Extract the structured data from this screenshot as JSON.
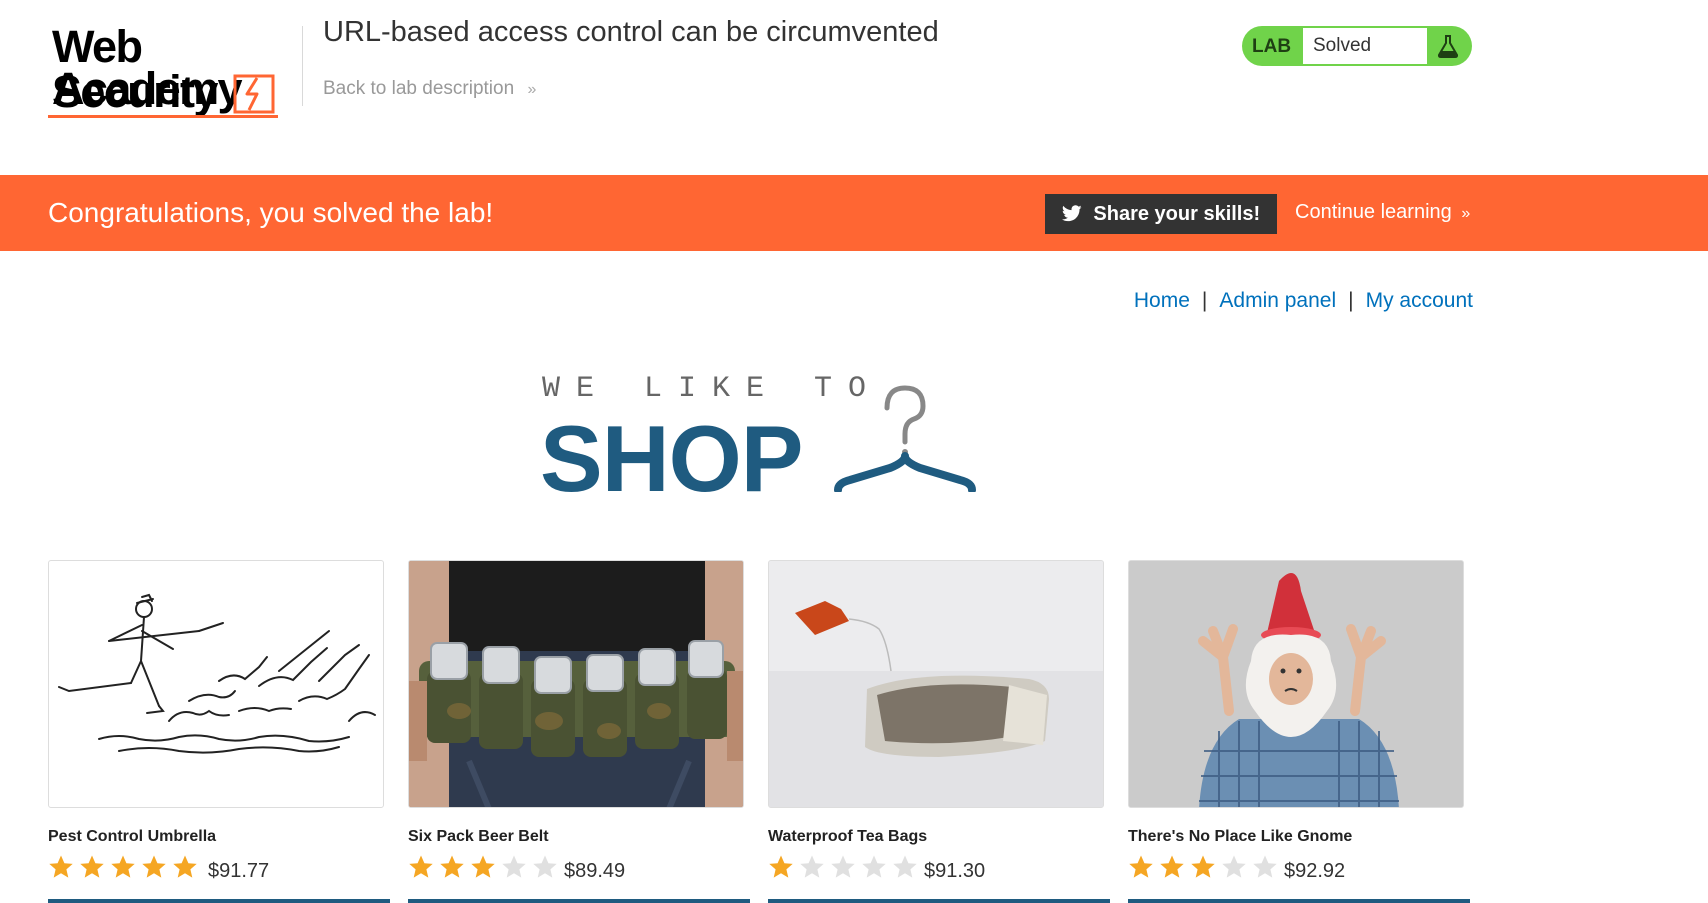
{
  "header": {
    "logo": {
      "line1": "Web Security",
      "line2": "Academy"
    },
    "lab_title": "URL-based access control can be circumvented",
    "back_link": "Back to lab description",
    "status": {
      "tag": "LAB",
      "text": "Solved",
      "icon": "flask-icon"
    }
  },
  "banner": {
    "message": "Congratulations, you solved the lab!",
    "share_label": "Share your skills!",
    "share_icon": "twitter-icon",
    "continue_label": "Continue learning"
  },
  "nav": {
    "items": [
      {
        "label": "Home"
      },
      {
        "label": "Admin panel"
      },
      {
        "label": "My account"
      }
    ],
    "separator": "|"
  },
  "shop_banner": {
    "top_text": "WE LIKE TO",
    "big_text": "SHOP",
    "icon": "hanger-icon"
  },
  "products": [
    {
      "name": "Pest Control Umbrella",
      "rating": 5,
      "price": "$91.77",
      "image": "umbrella-cartoon"
    },
    {
      "name": "Six Pack Beer Belt",
      "rating": 3,
      "price": "$89.49",
      "image": "beer-belt-photo"
    },
    {
      "name": "Waterproof Tea Bags",
      "rating": 1,
      "price": "$91.30",
      "image": "tea-bag-photo"
    },
    {
      "name": "There's No Place Like Gnome",
      "rating": 3,
      "price": "$92.92",
      "image": "gnome-photo"
    }
  ],
  "colors": {
    "accent": "#ff6633",
    "status_green": "#70d34a",
    "link_blue": "#0071bc",
    "brand_blue": "#1f5b80",
    "star_gold": "#f5a623",
    "star_grey": "#e0e0e0"
  }
}
